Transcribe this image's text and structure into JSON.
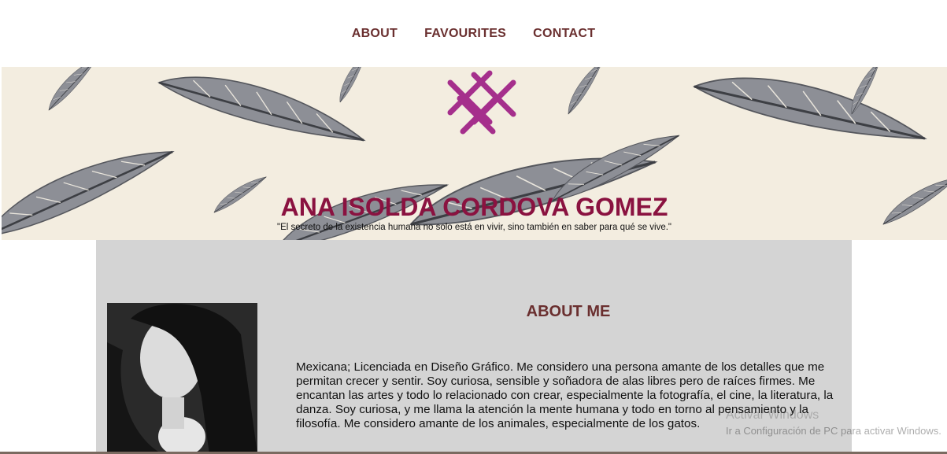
{
  "nav": {
    "items": [
      {
        "label": "ABOUT"
      },
      {
        "label": "FAVOURITES"
      },
      {
        "label": "CONTACT"
      }
    ]
  },
  "header": {
    "title": "ANA ISOLDA CORDOVA GOMEZ",
    "quote": "\"El secreto de la existencia humana no solo está en vivir, sino también en saber para qué se vive.\""
  },
  "about": {
    "heading": "ABOUT ME",
    "text": "Mexicana; Licenciada en Diseño Gráfico. Me considero una persona amante de los detalles que me permitan crecer y sentir. Soy curiosa, sensible y soñadora de alas libres pero de raíces firmes. Me encantan las artes y todo lo relacionado con crear, especialmente la fotografía, el cine, la literatura, la danza. Soy curiosa, y me llama la atención la mente humana y todo en torno al pensamiento y la filosofía. Me considero amante de los animales, especialmente de los gatos."
  },
  "os_overlay": {
    "line1": "Activar Windows",
    "line2": "Ir a Configuración de PC para activar Windows."
  },
  "colors": {
    "nav_text": "#6a2f2f",
    "title": "#8a1240",
    "logo": "#a52f8c",
    "banner_bg": "#f3ede0",
    "content_bg": "#d4d4d4"
  }
}
